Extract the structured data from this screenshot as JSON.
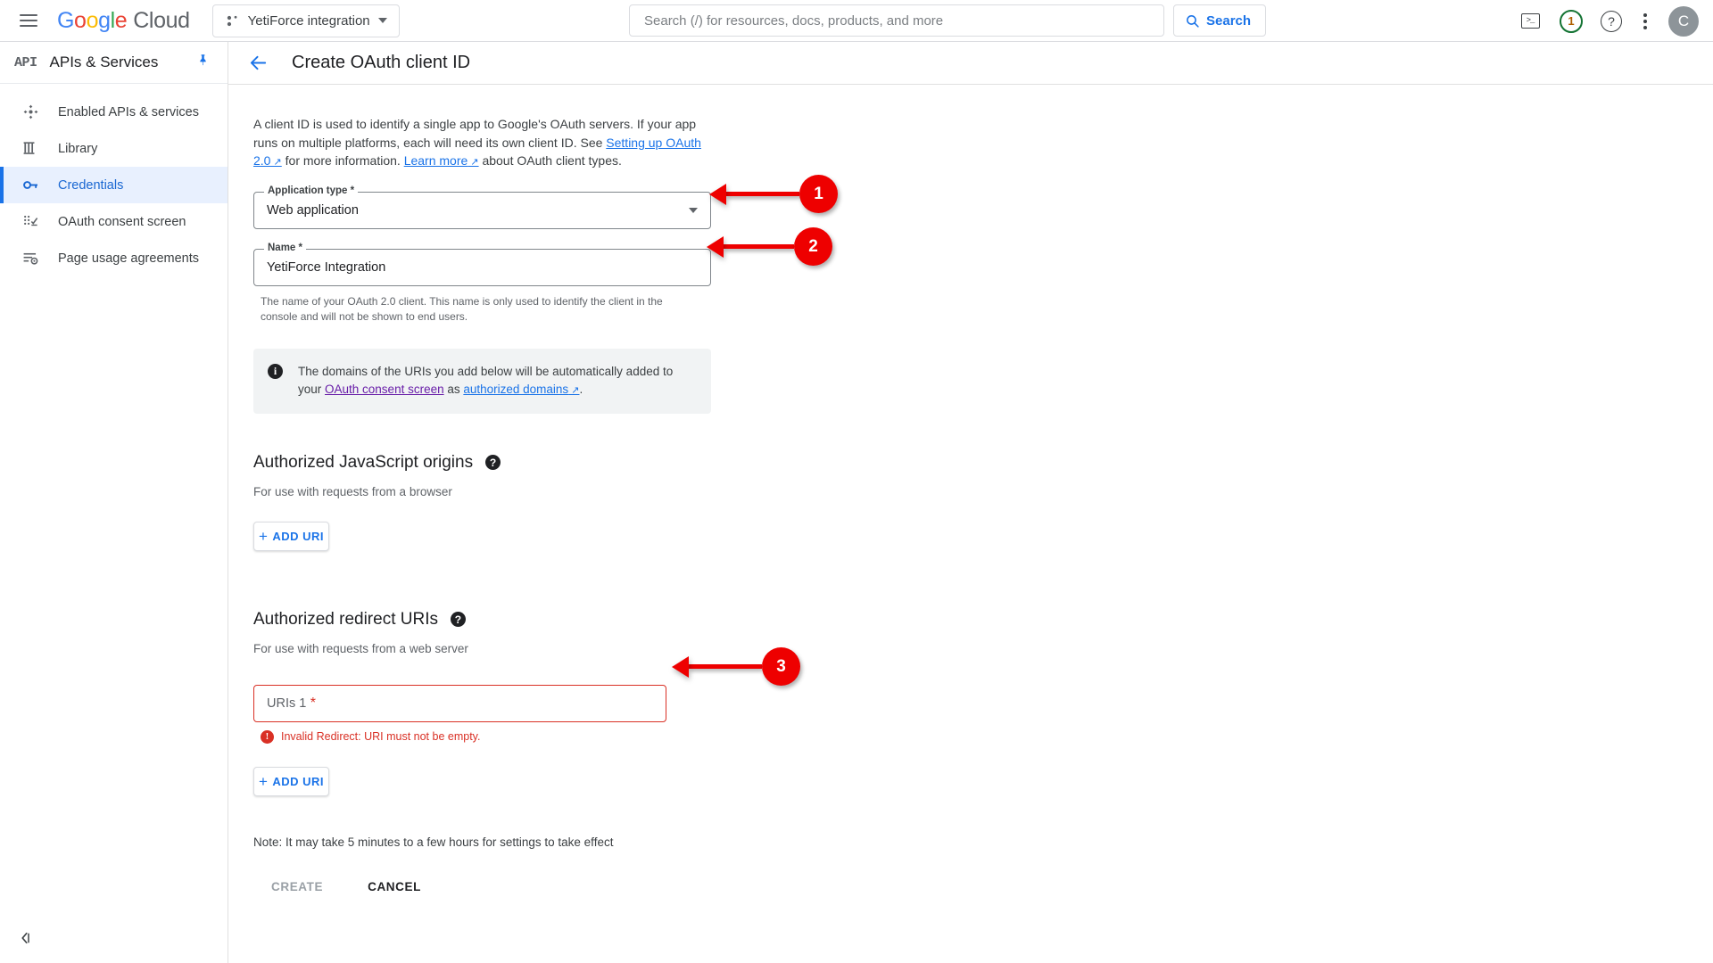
{
  "topbar": {
    "menu_icon": "hamburger-icon",
    "logo": {
      "google": "Google",
      "cloud": "Cloud"
    },
    "project": {
      "name": "YetiForce integration",
      "icon": "project-icon"
    },
    "search": {
      "placeholder": "Search (/) for resources, docs, products, and more",
      "value": "",
      "button_label": "Search",
      "icon": "search-icon"
    },
    "icons": {
      "terminal": ">_",
      "notifications_count": "1",
      "help": "?",
      "more": "kebab-icon",
      "avatar_initial": "C"
    }
  },
  "sidebar": {
    "product_glyph": "API",
    "title": "APIs & Services",
    "pin": "pin-icon",
    "items": [
      {
        "label": "Enabled APIs & services",
        "icon": "dashboard-icon",
        "active": false
      },
      {
        "label": "Library",
        "icon": "library-icon",
        "active": false
      },
      {
        "label": "Credentials",
        "icon": "key-icon",
        "active": true
      },
      {
        "label": "OAuth consent screen",
        "icon": "consent-icon",
        "active": false
      },
      {
        "label": "Page usage agreements",
        "icon": "agreements-icon",
        "active": false
      }
    ],
    "collapse_label": "‹|"
  },
  "page": {
    "back_icon": "back-arrow-icon",
    "title": "Create OAuth client ID",
    "intro": {
      "part1": "A client ID is used to identify a single app to Google's OAuth servers. If your app runs on multiple platforms, each will need its own client ID. See ",
      "link1": "Setting up OAuth 2.0",
      "part2": " for more information. ",
      "link2": "Learn more",
      "part3": " about OAuth client types."
    },
    "application_type": {
      "label": "Application type *",
      "value": "Web application"
    },
    "name_field": {
      "label": "Name *",
      "value": "YetiForce Integration",
      "helper": "The name of your OAuth 2.0 client. This name is only used to identify the client in the console and will not be shown to end users."
    },
    "info_banner": {
      "icon": "info-icon",
      "text_part1": "The domains of the URIs you add below will be automatically added to your ",
      "link1": "OAuth consent screen",
      "text_part2": " as ",
      "link2": "authorized domains",
      "text_part3": "."
    },
    "js_origins": {
      "title": "Authorized JavaScript origins",
      "help_icon": "help-icon",
      "subtitle": "For use with requests from a browser",
      "add_button": "ADD URI"
    },
    "redirect_uris": {
      "title": "Authorized redirect URIs",
      "help_icon": "help-icon",
      "subtitle": "For use with requests from a web server",
      "uri_field_label": "URIs 1",
      "uri_field_value": "",
      "error": "Invalid Redirect: URI must not be empty.",
      "add_button": "ADD URI"
    },
    "note": "Note: It may take 5 minutes to a few hours for settings to take effect",
    "buttons": {
      "create": "CREATE",
      "cancel": "CANCEL"
    }
  },
  "callouts": [
    {
      "number": "1"
    },
    {
      "number": "2"
    },
    {
      "number": "3"
    }
  ],
  "colors": {
    "accent_blue": "#1a73e8",
    "error_red": "#d93025",
    "callout_red": "#ee0000",
    "active_bg": "#e8f0fe"
  }
}
